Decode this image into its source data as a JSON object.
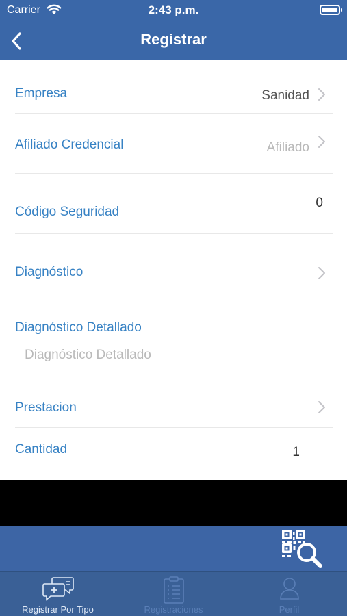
{
  "status_bar": {
    "carrier": "Carrier",
    "time": "2:43 p.m."
  },
  "nav": {
    "title": "Registrar"
  },
  "form": {
    "empresa": {
      "label": "Empresa",
      "value": "Sanidad"
    },
    "afiliado": {
      "label": "Afiliado Credencial",
      "placeholder": "Afiliado"
    },
    "codigo": {
      "label": "Código Seguridad",
      "value": "0"
    },
    "diagnostico": {
      "label": "Diagnóstico"
    },
    "diagnostico_detallado": {
      "label": "Diagnóstico Detallado",
      "placeholder": "Diagnóstico Detallado"
    },
    "prestacion": {
      "label": "Prestacion"
    },
    "cantidad": {
      "label": "Cantidad",
      "value": "1"
    }
  },
  "tabs": [
    {
      "label": "Registrar Por Tipo",
      "active": true
    },
    {
      "label": "Registraciones",
      "active": false
    },
    {
      "label": "Perfil",
      "active": false
    }
  ],
  "colors": {
    "primary": "#3a67a8",
    "label_blue": "#3782c4",
    "tab_bar": "#3a6096"
  }
}
